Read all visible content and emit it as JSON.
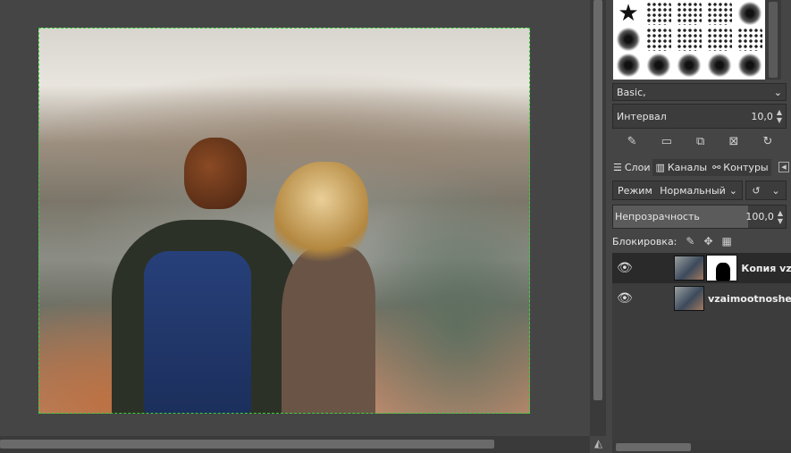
{
  "brushes": {
    "preset": "Basic,",
    "interval_label": "Интервал",
    "interval_value": "10,0"
  },
  "layers_panel": {
    "tabs": [
      {
        "label": "Слои"
      },
      {
        "label": "Каналы"
      },
      {
        "label": "Контуры"
      }
    ],
    "mode_label": "Режим",
    "mode_value": "Нормальный",
    "opacity_label": "Непрозрачность",
    "opacity_value": "100,0",
    "opacity_fraction": 1.0,
    "lock_label": "Блокировка:",
    "layers": [
      {
        "name": "Копия vz",
        "visible": true,
        "has_mask": true,
        "selected": true
      },
      {
        "name": "vzaimootnoshe",
        "visible": true,
        "has_mask": false,
        "selected": false
      }
    ]
  },
  "colors": {
    "selection_marquee": "#3bd13b",
    "panel_bg": "#454545"
  }
}
